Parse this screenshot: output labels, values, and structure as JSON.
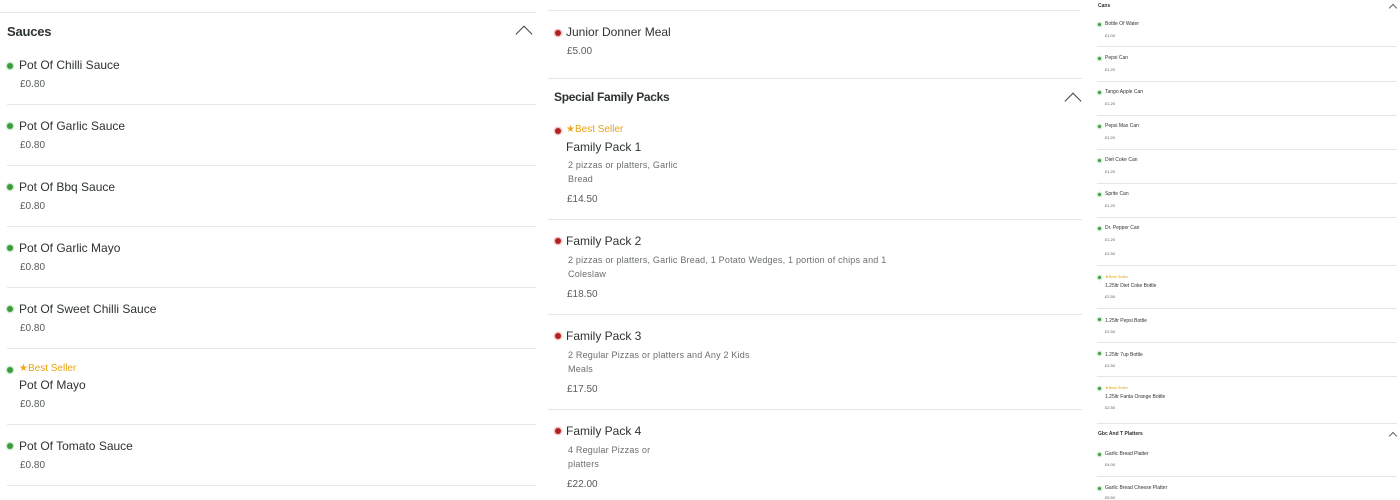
{
  "colors": {
    "accent_green": "#3a9c3a",
    "accent_red": "#b32020",
    "best_seller": "#e8a317",
    "divider": "#e6e6e6"
  },
  "sauces": {
    "title": "Sauces",
    "items": [
      {
        "name": "Pot Of Chilli Sauce",
        "price": "£0.80"
      },
      {
        "name": "Pot Of Garlic Sauce",
        "price": "£0.80"
      },
      {
        "name": "Pot Of Bbq Sauce",
        "price": "£0.80"
      },
      {
        "name": "Pot Of Garlic Mayo",
        "price": "£0.80"
      },
      {
        "name": "Pot Of Sweet Chilli Sauce",
        "price": "£0.80"
      },
      {
        "name": "Pot Of Mayo",
        "price": "£0.80",
        "badge": "Best Seller"
      },
      {
        "name": "Pot Of Tomato Sauce",
        "price": "£0.80"
      }
    ]
  },
  "middle": {
    "junior": {
      "name": "Junior Donner Meal",
      "price": "£5.00"
    },
    "family": {
      "title": "Special Family Packs",
      "items": [
        {
          "badge": "Best Seller",
          "name": "Family Pack 1",
          "desc1": "2 pizzas or platters, Garlic",
          "desc2": "Bread",
          "price": "£14.50"
        },
        {
          "name": "Family Pack 2",
          "desc1": "2 pizzas or platters, Garlic Bread, 1 Potato Wedges, 1 portion of chips and 1",
          "desc2": "Coleslaw",
          "price": "£18.50"
        },
        {
          "name": "Family Pack 3",
          "desc1": "2 Regular Pizzas or platters and Any 2 Kids",
          "desc2": "Meals",
          "price": "£17.50"
        },
        {
          "name": "Family Pack 4",
          "desc1": "4 Regular Pizzas or",
          "desc2": "platters",
          "price": "£22.00"
        }
      ]
    }
  },
  "right": {
    "cans_title": "Cans",
    "cans": [
      {
        "name": "Bottle Of Water",
        "price": "£1.00"
      },
      {
        "name": "Pepsi Can",
        "price": "£1.20"
      },
      {
        "name": "Tango Apple Can",
        "price": "£1.20"
      },
      {
        "name": "Pepsi Max Can",
        "price": "£1.20"
      },
      {
        "name": "Diet Coke Can",
        "price": "£1.20"
      },
      {
        "name": "Sprite Can",
        "price": "£1.20"
      },
      {
        "name": "Dr. Pepper Can",
        "price": "£1.20"
      }
    ],
    "bottles": [
      {
        "badge": "Best Seller",
        "name": "1.25ltr Diet Coke Bottle",
        "price": "£2.50"
      },
      {
        "name": "1.25ltr Pepsi Bottle",
        "price": "£2.50"
      },
      {
        "name": "1.25ltr 7up Bottle",
        "price": "£2.50"
      },
      {
        "badge": "Best Seller",
        "name": "1.25ltr Fanta Orange Bottle",
        "price": "£2.50"
      }
    ],
    "stray_price": "£2.50",
    "gbc_title": "Gbc And T Platters",
    "gbc": [
      {
        "name": "Garlic Bread Platter",
        "price": "£4.00"
      },
      {
        "name": "Garlic Bread Cheese Platter",
        "price": "£5.50"
      }
    ]
  }
}
